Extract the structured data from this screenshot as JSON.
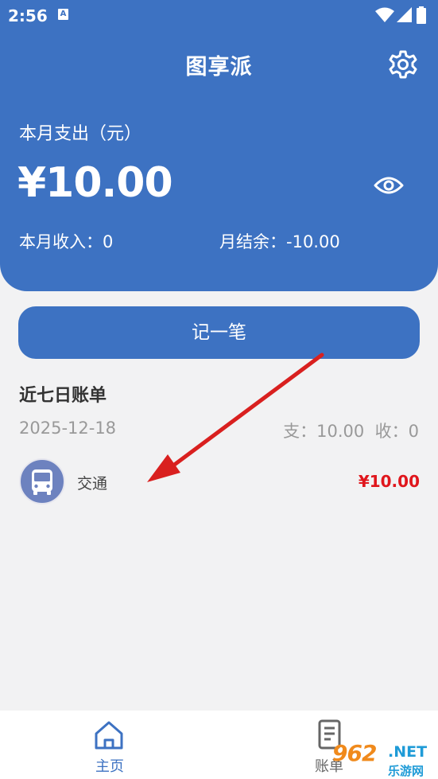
{
  "status_bar": {
    "time": "2:56",
    "notification_badge": "A"
  },
  "header": {
    "title": "图享派",
    "expense_label": "本月支出（元）",
    "expense_amount": "¥10.00",
    "income_label": "本月收入：",
    "income_value": "0",
    "balance_label": "月结余：",
    "balance_value": "-10.00",
    "background_color": "#3d72c2"
  },
  "actions": {
    "record_label": "记一笔"
  },
  "recent_bills": {
    "title": "近七日账单",
    "groups": [
      {
        "date": "2025-12-18",
        "expense_label": "支：",
        "expense_value": "10.00",
        "income_label": "收：",
        "income_value": "0",
        "items": [
          {
            "category": "交通",
            "icon": "bus-icon",
            "amount": "¥10.00"
          }
        ]
      }
    ]
  },
  "bottom_nav": {
    "items": [
      {
        "label": "主页",
        "icon": "home-icon",
        "active": true
      },
      {
        "label": "账单",
        "icon": "bill-icon",
        "active": false
      }
    ]
  },
  "watermark": {
    "logo": "962",
    "net": ".NET",
    "subtitle": "乐游网"
  },
  "colors": {
    "accent": "#3d72c2",
    "amount_red": "#e0161c",
    "annotation_arrow": "#d9201f"
  }
}
